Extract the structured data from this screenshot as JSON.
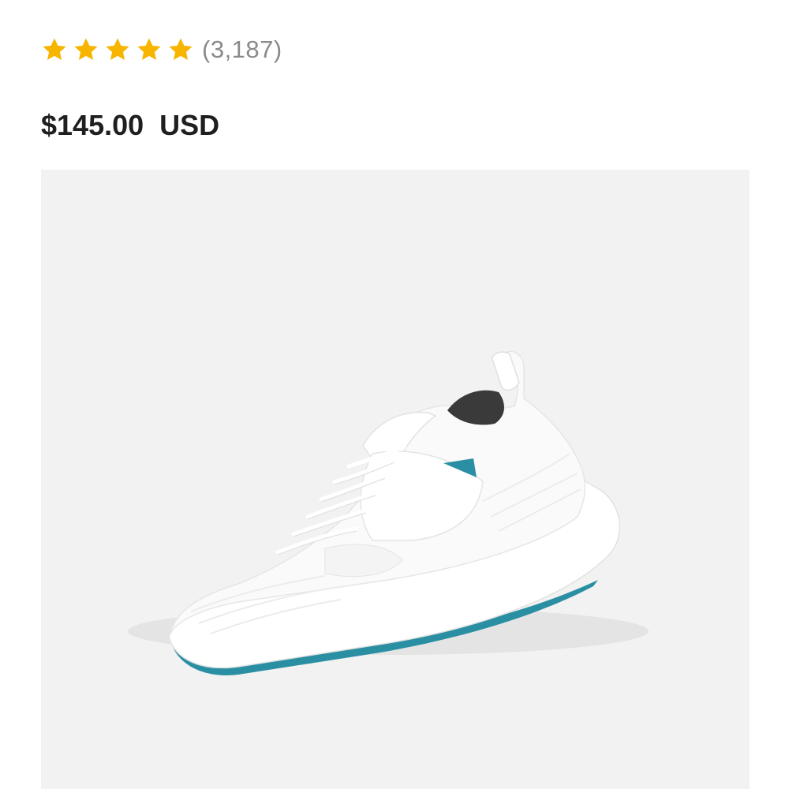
{
  "product": {
    "title": "",
    "rating": {
      "value": 5,
      "max": 5,
      "review_count_text": "(3,187)"
    },
    "price": {
      "amount": "$145.00",
      "currency": "USD"
    },
    "image": {
      "subject": "shoe-icon",
      "colors": {
        "background": "#f2f2f2",
        "upper": "#ffffff",
        "accent": "#2a8fa3",
        "lining": "#3a3a3a"
      }
    }
  },
  "colors": {
    "star": "#f7b500",
    "review_count": "#8a8a8a",
    "price": "#1f1f1f"
  }
}
